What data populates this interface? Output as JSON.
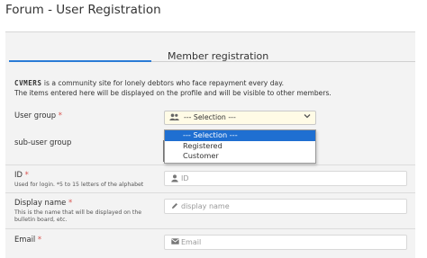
{
  "page": {
    "title": "Forum - User Registration"
  },
  "tab": {
    "label": "Member registration"
  },
  "intro": {
    "brand": "CVMERS",
    "line1": "is a community site for lonely debtors who face repayment every day.",
    "line2": "The items entered here will be displayed on the profile and will be visible to other members."
  },
  "fields": {
    "user_group": {
      "label": "User group",
      "required": "*",
      "value": "--- Selection ---"
    },
    "sub_user_group": {
      "label": "sub-user group"
    },
    "id": {
      "label": "ID",
      "required": "*",
      "hint": "Used for login. *5 to 15 letters of the alphabet",
      "placeholder": "ID"
    },
    "display_name": {
      "label": "Display name",
      "required": "*",
      "hint1": "This is the name that will be displayed on the",
      "hint2": "bulletin board, etc.",
      "placeholder": "display name"
    },
    "email": {
      "label": "Email",
      "required": "*",
      "placeholder": "Email"
    }
  },
  "dropdown": {
    "options": [
      "--- Selection ---",
      "Registered",
      "Customer"
    ],
    "selected_index": 0
  },
  "icons": {
    "user_group": "users-icon",
    "id": "user-icon",
    "display_name": "pencil-icon",
    "email": "envelope-icon"
  },
  "colors": {
    "accent": "#2a7bd6",
    "required": "#d9534f",
    "highlight": "#1f6fd1",
    "select_bg": "#fffbe6"
  }
}
